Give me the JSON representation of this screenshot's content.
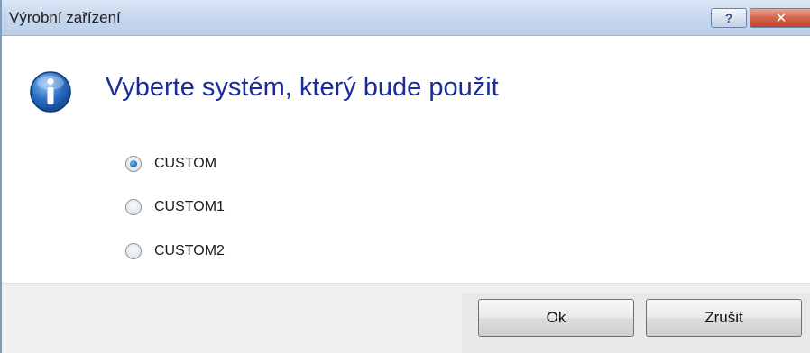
{
  "window": {
    "title": "Výrobní zařízení",
    "help_glyph": "?",
    "close_glyph": "✕"
  },
  "main": {
    "heading": "Vyberte systém, který bude použit",
    "icon": "info-icon",
    "options": [
      {
        "label": "CUSTOM",
        "selected": true
      },
      {
        "label": "CUSTOM1",
        "selected": false
      },
      {
        "label": "CUSTOM2",
        "selected": false
      }
    ]
  },
  "buttons": {
    "ok_label": "Ok",
    "cancel_label": "Zrušit"
  },
  "colors": {
    "heading": "#1a2c9c",
    "selected_radio": "#1f76b8",
    "footer_bg": "#f0f0f0"
  }
}
